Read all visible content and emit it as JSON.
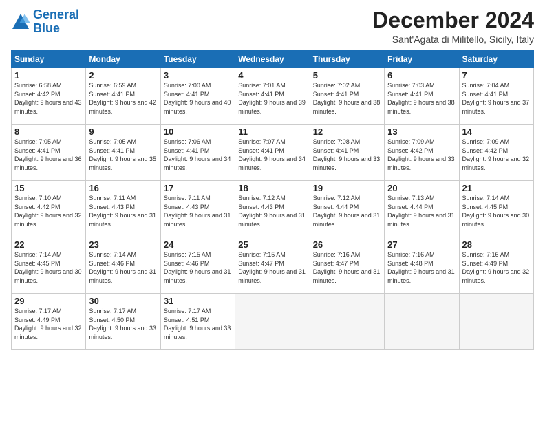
{
  "logo": {
    "line1": "General",
    "line2": "Blue"
  },
  "title": "December 2024",
  "location": "Sant'Agata di Militello, Sicily, Italy",
  "days_of_week": [
    "Sunday",
    "Monday",
    "Tuesday",
    "Wednesday",
    "Thursday",
    "Friday",
    "Saturday"
  ],
  "weeks": [
    [
      {
        "day": "1",
        "sunrise": "6:58 AM",
        "sunset": "4:42 PM",
        "daylight": "9 hours and 43 minutes."
      },
      {
        "day": "2",
        "sunrise": "6:59 AM",
        "sunset": "4:41 PM",
        "daylight": "9 hours and 42 minutes."
      },
      {
        "day": "3",
        "sunrise": "7:00 AM",
        "sunset": "4:41 PM",
        "daylight": "9 hours and 40 minutes."
      },
      {
        "day": "4",
        "sunrise": "7:01 AM",
        "sunset": "4:41 PM",
        "daylight": "9 hours and 39 minutes."
      },
      {
        "day": "5",
        "sunrise": "7:02 AM",
        "sunset": "4:41 PM",
        "daylight": "9 hours and 38 minutes."
      },
      {
        "day": "6",
        "sunrise": "7:03 AM",
        "sunset": "4:41 PM",
        "daylight": "9 hours and 38 minutes."
      },
      {
        "day": "7",
        "sunrise": "7:04 AM",
        "sunset": "4:41 PM",
        "daylight": "9 hours and 37 minutes."
      }
    ],
    [
      {
        "day": "8",
        "sunrise": "7:05 AM",
        "sunset": "4:41 PM",
        "daylight": "9 hours and 36 minutes."
      },
      {
        "day": "9",
        "sunrise": "7:05 AM",
        "sunset": "4:41 PM",
        "daylight": "9 hours and 35 minutes."
      },
      {
        "day": "10",
        "sunrise": "7:06 AM",
        "sunset": "4:41 PM",
        "daylight": "9 hours and 34 minutes."
      },
      {
        "day": "11",
        "sunrise": "7:07 AM",
        "sunset": "4:41 PM",
        "daylight": "9 hours and 34 minutes."
      },
      {
        "day": "12",
        "sunrise": "7:08 AM",
        "sunset": "4:41 PM",
        "daylight": "9 hours and 33 minutes."
      },
      {
        "day": "13",
        "sunrise": "7:09 AM",
        "sunset": "4:42 PM",
        "daylight": "9 hours and 33 minutes."
      },
      {
        "day": "14",
        "sunrise": "7:09 AM",
        "sunset": "4:42 PM",
        "daylight": "9 hours and 32 minutes."
      }
    ],
    [
      {
        "day": "15",
        "sunrise": "7:10 AM",
        "sunset": "4:42 PM",
        "daylight": "9 hours and 32 minutes."
      },
      {
        "day": "16",
        "sunrise": "7:11 AM",
        "sunset": "4:43 PM",
        "daylight": "9 hours and 31 minutes."
      },
      {
        "day": "17",
        "sunrise": "7:11 AM",
        "sunset": "4:43 PM",
        "daylight": "9 hours and 31 minutes."
      },
      {
        "day": "18",
        "sunrise": "7:12 AM",
        "sunset": "4:43 PM",
        "daylight": "9 hours and 31 minutes."
      },
      {
        "day": "19",
        "sunrise": "7:12 AM",
        "sunset": "4:44 PM",
        "daylight": "9 hours and 31 minutes."
      },
      {
        "day": "20",
        "sunrise": "7:13 AM",
        "sunset": "4:44 PM",
        "daylight": "9 hours and 31 minutes."
      },
      {
        "day": "21",
        "sunrise": "7:14 AM",
        "sunset": "4:45 PM",
        "daylight": "9 hours and 30 minutes."
      }
    ],
    [
      {
        "day": "22",
        "sunrise": "7:14 AM",
        "sunset": "4:45 PM",
        "daylight": "9 hours and 30 minutes."
      },
      {
        "day": "23",
        "sunrise": "7:14 AM",
        "sunset": "4:46 PM",
        "daylight": "9 hours and 31 minutes."
      },
      {
        "day": "24",
        "sunrise": "7:15 AM",
        "sunset": "4:46 PM",
        "daylight": "9 hours and 31 minutes."
      },
      {
        "day": "25",
        "sunrise": "7:15 AM",
        "sunset": "4:47 PM",
        "daylight": "9 hours and 31 minutes."
      },
      {
        "day": "26",
        "sunrise": "7:16 AM",
        "sunset": "4:47 PM",
        "daylight": "9 hours and 31 minutes."
      },
      {
        "day": "27",
        "sunrise": "7:16 AM",
        "sunset": "4:48 PM",
        "daylight": "9 hours and 31 minutes."
      },
      {
        "day": "28",
        "sunrise": "7:16 AM",
        "sunset": "4:49 PM",
        "daylight": "9 hours and 32 minutes."
      }
    ],
    [
      {
        "day": "29",
        "sunrise": "7:17 AM",
        "sunset": "4:49 PM",
        "daylight": "9 hours and 32 minutes."
      },
      {
        "day": "30",
        "sunrise": "7:17 AM",
        "sunset": "4:50 PM",
        "daylight": "9 hours and 33 minutes."
      },
      {
        "day": "31",
        "sunrise": "7:17 AM",
        "sunset": "4:51 PM",
        "daylight": "9 hours and 33 minutes."
      },
      null,
      null,
      null,
      null
    ]
  ]
}
